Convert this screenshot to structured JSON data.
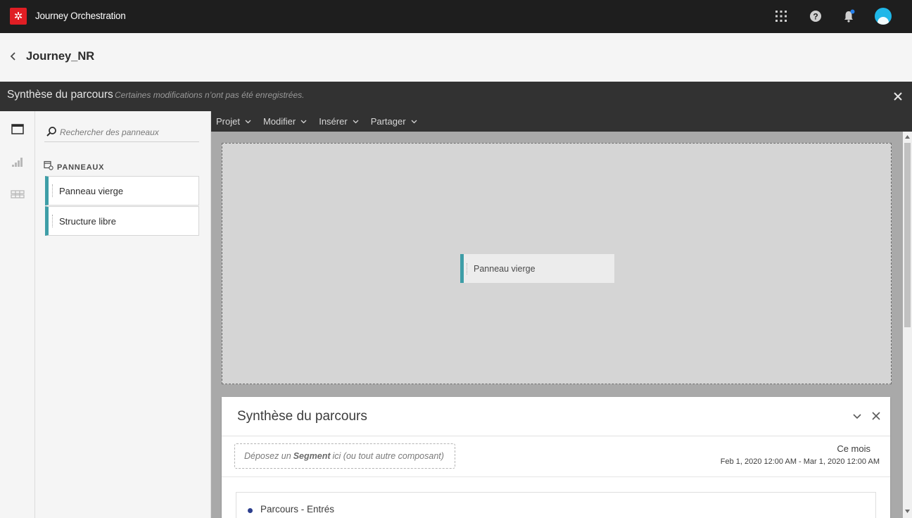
{
  "app": {
    "title": "Journey Orchestration",
    "logo_icon": "adobe-experience-icon",
    "brand_color": "#e01e24"
  },
  "topbar_icons": [
    "apps-grid-icon",
    "help-icon",
    "notifications-bell-icon",
    "user-avatar"
  ],
  "header": {
    "journey_name": "Journey_NR"
  },
  "workspace": {
    "title": "Synthèse du parcours",
    "unsaved_note": "Certaines modifications n’ont pas été enregistrées."
  },
  "left_rail": [
    "panels-icon",
    "visualizations-icon",
    "components-icon"
  ],
  "panel_library": {
    "search_placeholder": "Rechercher des panneaux",
    "section_label": "PANNEAUX",
    "items": [
      {
        "label": "Panneau vierge"
      },
      {
        "label": "Structure libre"
      }
    ],
    "accent_color": "#3e9ea7"
  },
  "menu": [
    {
      "label": "Projet"
    },
    {
      "label": "Modifier"
    },
    {
      "label": "Insérer"
    },
    {
      "label": "Partager"
    }
  ],
  "canvas": {
    "dragged_panel_label": "Panneau vierge"
  },
  "summary_panel": {
    "title": "Synthèse du parcours",
    "segment_drop_prefix": "Déposez un",
    "segment_drop_bold": "Segment",
    "segment_drop_suffix": "ici (ou tout autre composant)",
    "period": "Ce mois",
    "date_range": "Feb 1, 2020 12:00 AM - Mar 1, 2020 12:00 AM",
    "metric_label": "Parcours - Entrés",
    "metric_dot_color": "#2d3f8e"
  }
}
